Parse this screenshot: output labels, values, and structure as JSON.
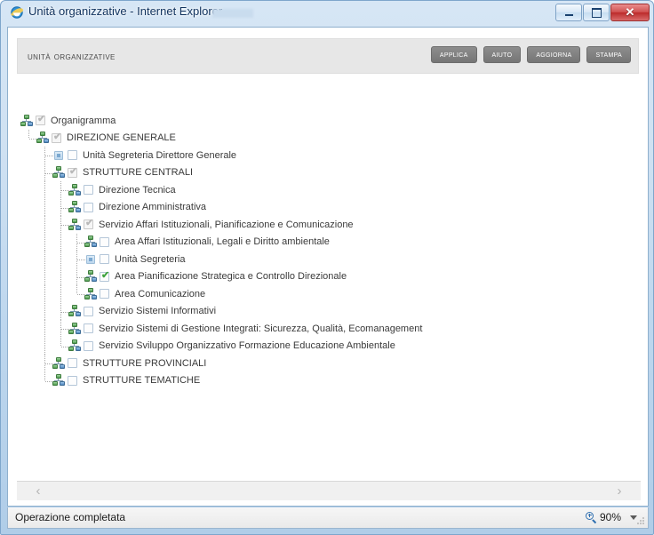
{
  "window": {
    "title": "Unità organizzative - Internet Explorer",
    "icon": "internet-explorer-icon",
    "caption_buttons": {
      "minimize": "Riduci a icona",
      "maximize": "Ingrandisci",
      "close": "Chiudi",
      "close_glyph": "✕"
    }
  },
  "page": {
    "heading": "Unità organizzative",
    "buttons": [
      {
        "label": "Applica",
        "name": "applica-button"
      },
      {
        "label": "Aiuto",
        "name": "aiuto-button"
      },
      {
        "label": "Aggiorna",
        "name": "aggiorna-button"
      },
      {
        "label": "Stampa",
        "name": "stampa-button"
      }
    ]
  },
  "tree": {
    "check_glyph": "✔",
    "nodes": [
      {
        "label": "Organigramma",
        "level": 0,
        "icon": "org-chart-icon",
        "checked": "dim",
        "last": false
      },
      {
        "label": "DIREZIONE GENERALE",
        "level": 1,
        "icon": "org-chart-icon",
        "checked": "dim",
        "last": true
      },
      {
        "label": "Unità Segreteria Direttore Generale",
        "level": 2,
        "icon": "unit-icon",
        "checked": "none",
        "last": false
      },
      {
        "label": "STRUTTURE CENTRALI",
        "level": 2,
        "icon": "org-chart-icon",
        "checked": "dim",
        "last": false
      },
      {
        "label": "Direzione Tecnica",
        "level": 3,
        "icon": "org-chart-icon",
        "checked": "none",
        "last": false
      },
      {
        "label": "Direzione Amministrativa",
        "level": 3,
        "icon": "org-chart-icon",
        "checked": "none",
        "last": false
      },
      {
        "label": "Servizio Affari Istituzionali, Pianificazione e Comunicazione",
        "level": 3,
        "icon": "org-chart-icon",
        "checked": "dim",
        "last": false
      },
      {
        "label": "Area Affari Istituzionali, Legali e Diritto ambientale",
        "level": 4,
        "icon": "org-chart-icon",
        "checked": "none",
        "last": false
      },
      {
        "label": "Unità Segreteria",
        "level": 4,
        "icon": "unit-icon",
        "checked": "none",
        "last": false
      },
      {
        "label": "Area Pianificazione Strategica e Controllo Direzionale",
        "level": 4,
        "icon": "org-chart-icon",
        "checked": "green",
        "last": false
      },
      {
        "label": "Area Comunicazione",
        "level": 4,
        "icon": "org-chart-icon",
        "checked": "none",
        "last": true
      },
      {
        "label": "Servizio Sistemi Informativi",
        "level": 3,
        "icon": "org-chart-icon",
        "checked": "none",
        "last": false
      },
      {
        "label": "Servizio Sistemi di Gestione Integrati: Sicurezza, Qualità, Ecomanagement",
        "level": 3,
        "icon": "org-chart-icon",
        "checked": "none",
        "last": false
      },
      {
        "label": "Servizio Sviluppo Organizzativo Formazione Educazione Ambientale",
        "level": 3,
        "icon": "org-chart-icon",
        "checked": "none",
        "last": true
      },
      {
        "label": "STRUTTURE PROVINCIALI",
        "level": 2,
        "icon": "org-chart-icon",
        "checked": "none",
        "last": false
      },
      {
        "label": "STRUTTURE TEMATICHE",
        "level": 2,
        "icon": "org-chart-icon",
        "checked": "none",
        "last": true
      }
    ]
  },
  "navigation": {
    "prev_glyph": "‹",
    "next_glyph": "›"
  },
  "status": {
    "message": "Operazione completata",
    "zoom_level": "90%",
    "zoom_icon": "zoom-magnifier-icon"
  },
  "colors": {
    "accent": "#2f6fb0",
    "check_green": "#3fa33f",
    "header_strip": "#e7e7e7",
    "button_gray": "#767676",
    "close_red": "#bc2b2b"
  }
}
